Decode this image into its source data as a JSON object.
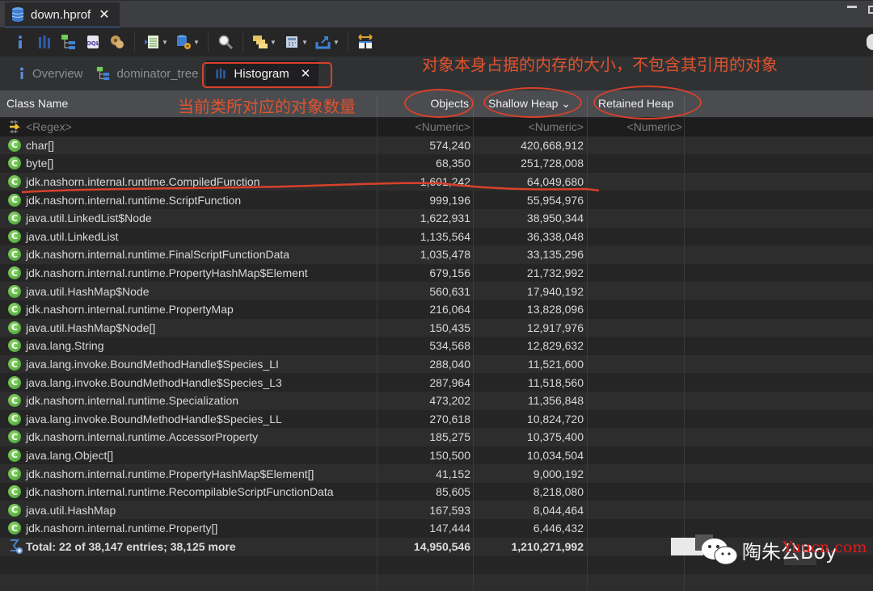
{
  "editor": {
    "file_tab": "down.hprof",
    "close_glyph": "✕"
  },
  "toolbar": {
    "buttons": [
      {
        "name": "overview",
        "icon": "info-icon"
      },
      {
        "name": "histogram",
        "icon": "histogram-icon"
      },
      {
        "name": "dominator-tree",
        "icon": "dominator-tree-icon"
      },
      {
        "name": "oql",
        "icon": "oql-icon"
      },
      {
        "name": "thread-overview",
        "icon": "gears-icon"
      },
      {
        "name": "run-report",
        "icon": "report-icon",
        "dropdown": true
      },
      {
        "name": "heap-dump",
        "icon": "database-gear-icon",
        "dropdown": true
      },
      {
        "name": "search",
        "icon": "search-icon"
      },
      {
        "name": "group",
        "icon": "folders-icon",
        "dropdown": true
      },
      {
        "name": "calculate",
        "icon": "calculator-icon",
        "dropdown": true
      },
      {
        "name": "export",
        "icon": "export-icon",
        "dropdown": true
      },
      {
        "name": "compare",
        "icon": "compare-icon"
      }
    ]
  },
  "view_tabs": [
    {
      "label": "Overview",
      "icon": "info-icon",
      "active": false
    },
    {
      "label": "dominator_tree",
      "icon": "dominator-tree-icon",
      "active": false
    },
    {
      "label": "Histogram",
      "icon": "histogram-icon",
      "active": true,
      "closable": true
    }
  ],
  "annotations": {
    "shallow_heap_note": "对象本身占据的内存的大小，不包含其引用的对象",
    "objects_note": "当前类所对应的对象数量"
  },
  "table": {
    "columns": {
      "class_name": "Class Name",
      "objects": "Objects",
      "shallow_heap": "Shallow Heap",
      "shallow_heap_sort": "⌄",
      "retained_heap": "Retained Heap"
    },
    "filter_row": {
      "class_name": "<Regex>",
      "objects": "<Numeric>",
      "shallow_heap": "<Numeric>",
      "retained_heap": "<Numeric>"
    },
    "class_icon_glyph": "C",
    "rows": [
      {
        "class_name": "char[]",
        "objects": "574,240",
        "shallow_heap": "420,668,912"
      },
      {
        "class_name": "byte[]",
        "objects": "68,350",
        "shallow_heap": "251,728,008"
      },
      {
        "class_name": "jdk.nashorn.internal.runtime.CompiledFunction",
        "objects": "1,601,242",
        "shallow_heap": "64,049,680"
      },
      {
        "class_name": "jdk.nashorn.internal.runtime.ScriptFunction",
        "objects": "999,196",
        "shallow_heap": "55,954,976"
      },
      {
        "class_name": "java.util.LinkedList$Node",
        "objects": "1,622,931",
        "shallow_heap": "38,950,344"
      },
      {
        "class_name": "java.util.LinkedList",
        "objects": "1,135,564",
        "shallow_heap": "36,338,048"
      },
      {
        "class_name": "jdk.nashorn.internal.runtime.FinalScriptFunctionData",
        "objects": "1,035,478",
        "shallow_heap": "33,135,296"
      },
      {
        "class_name": "jdk.nashorn.internal.runtime.PropertyHashMap$Element",
        "objects": "679,156",
        "shallow_heap": "21,732,992"
      },
      {
        "class_name": "java.util.HashMap$Node",
        "objects": "560,631",
        "shallow_heap": "17,940,192"
      },
      {
        "class_name": "jdk.nashorn.internal.runtime.PropertyMap",
        "objects": "216,064",
        "shallow_heap": "13,828,096"
      },
      {
        "class_name": "java.util.HashMap$Node[]",
        "objects": "150,435",
        "shallow_heap": "12,917,976"
      },
      {
        "class_name": "java.lang.String",
        "objects": "534,568",
        "shallow_heap": "12,829,632"
      },
      {
        "class_name": "java.lang.invoke.BoundMethodHandle$Species_LI",
        "objects": "288,040",
        "shallow_heap": "11,521,600"
      },
      {
        "class_name": "java.lang.invoke.BoundMethodHandle$Species_L3",
        "objects": "287,964",
        "shallow_heap": "11,518,560"
      },
      {
        "class_name": "jdk.nashorn.internal.runtime.Specialization",
        "objects": "473,202",
        "shallow_heap": "11,356,848"
      },
      {
        "class_name": "java.lang.invoke.BoundMethodHandle$Species_LL",
        "objects": "270,618",
        "shallow_heap": "10,824,720"
      },
      {
        "class_name": "jdk.nashorn.internal.runtime.AccessorProperty",
        "objects": "185,275",
        "shallow_heap": "10,375,400"
      },
      {
        "class_name": "java.lang.Object[]",
        "objects": "150,500",
        "shallow_heap": "10,034,504"
      },
      {
        "class_name": "jdk.nashorn.internal.runtime.PropertyHashMap$Element[]",
        "objects": "41,152",
        "shallow_heap": "9,000,192"
      },
      {
        "class_name": "jdk.nashorn.internal.runtime.RecompilableScriptFunctionData",
        "objects": "85,605",
        "shallow_heap": "8,218,080"
      },
      {
        "class_name": "java.util.HashMap",
        "objects": "167,593",
        "shallow_heap": "8,044,464"
      },
      {
        "class_name": "jdk.nashorn.internal.runtime.Property[]",
        "objects": "147,444",
        "shallow_heap": "6,446,432"
      }
    ],
    "total_row": {
      "label": "Total: 22 of 38,147 entries; 38,125 more",
      "objects": "14,950,546",
      "shallow_heap": "1,210,271,992"
    }
  },
  "watermark": {
    "text": "陶朱公Boy",
    "site": "Yuucn.com"
  },
  "colors": {
    "annotation": "#d8412b",
    "class_icon": "#4fae37",
    "header_bg": "#4b4c50"
  }
}
